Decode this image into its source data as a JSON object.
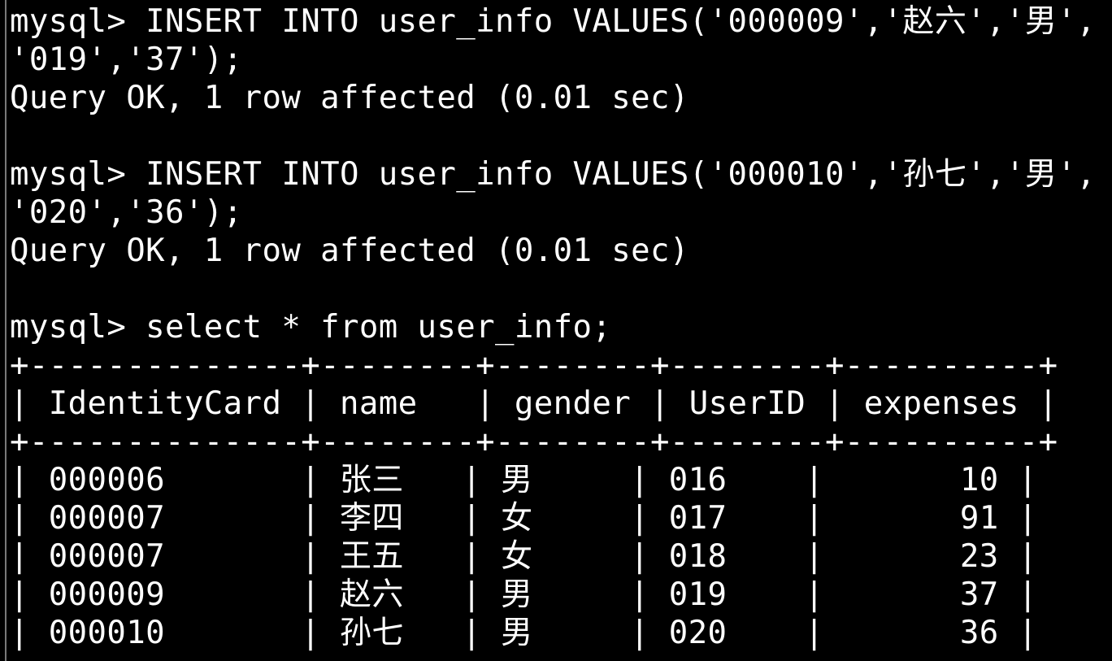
{
  "colors": {
    "background": "#000000",
    "text": "#ffffff"
  },
  "terminal": {
    "lines": [
      "mysql> INSERT INTO user_info VALUES('000009','赵六','男',",
      "'019','37');",
      "Query OK, 1 row affected (0.01 sec)",
      "",
      "mysql> INSERT INTO user_info VALUES('000010','孙七','男',",
      "'020','36');",
      "Query OK, 1 row affected (0.01 sec)",
      "",
      "mysql> select * from user_info;",
      "+--------------+--------+--------+--------+----------+",
      "| IdentityCard | name   | gender | UserID | expenses |",
      "+--------------+--------+--------+--------+----------+",
      "| 000006       | 张三   | 男     | 016    |       10 |",
      "| 000007       | 李四   | 女     | 017    |       91 |",
      "| 000007       | 王五   | 女     | 018    |       23 |",
      "| 000009       | 赵六   | 男     | 019    |       37 |",
      "| 000010       | 孙七   | 男     | 020    |       36 |"
    ]
  }
}
